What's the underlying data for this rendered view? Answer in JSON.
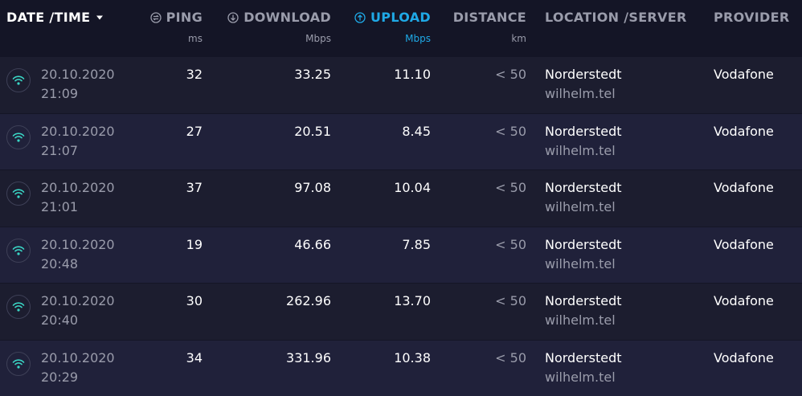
{
  "header": {
    "date_time": "DATE /TIME",
    "ping": "PING",
    "ping_unit": "ms",
    "download": "DOWNLOAD",
    "download_unit": "Mbps",
    "upload": "UPLOAD",
    "upload_unit": "Mbps",
    "distance": "DISTANCE",
    "distance_unit": "km",
    "location": "LOCATION /SERVER",
    "provider": "PROVIDER"
  },
  "colors": {
    "background": "#141526",
    "row": "#1c1d2f",
    "row_alt": "#20213a",
    "accent": "#1fa9e6",
    "wifi": "#3ad6c5",
    "muted": "#9a9cab"
  },
  "rows": [
    {
      "date": "20.10.2020",
      "time": "21:09",
      "ping": "32",
      "download": "33.25",
      "upload": "11.10",
      "distance": "< 50",
      "location": "Norderstedt",
      "server": "wilhelm.tel",
      "provider": "Vodafone"
    },
    {
      "date": "20.10.2020",
      "time": "21:07",
      "ping": "27",
      "download": "20.51",
      "upload": "8.45",
      "distance": "< 50",
      "location": "Norderstedt",
      "server": "wilhelm.tel",
      "provider": "Vodafone"
    },
    {
      "date": "20.10.2020",
      "time": "21:01",
      "ping": "37",
      "download": "97.08",
      "upload": "10.04",
      "distance": "< 50",
      "location": "Norderstedt",
      "server": "wilhelm.tel",
      "provider": "Vodafone"
    },
    {
      "date": "20.10.2020",
      "time": "20:48",
      "ping": "19",
      "download": "46.66",
      "upload": "7.85",
      "distance": "< 50",
      "location": "Norderstedt",
      "server": "wilhelm.tel",
      "provider": "Vodafone"
    },
    {
      "date": "20.10.2020",
      "time": "20:40",
      "ping": "30",
      "download": "262.96",
      "upload": "13.70",
      "distance": "< 50",
      "location": "Norderstedt",
      "server": "wilhelm.tel",
      "provider": "Vodafone"
    },
    {
      "date": "20.10.2020",
      "time": "20:29",
      "ping": "34",
      "download": "331.96",
      "upload": "10.38",
      "distance": "< 50",
      "location": "Norderstedt",
      "server": "wilhelm.tel",
      "provider": "Vodafone"
    }
  ]
}
